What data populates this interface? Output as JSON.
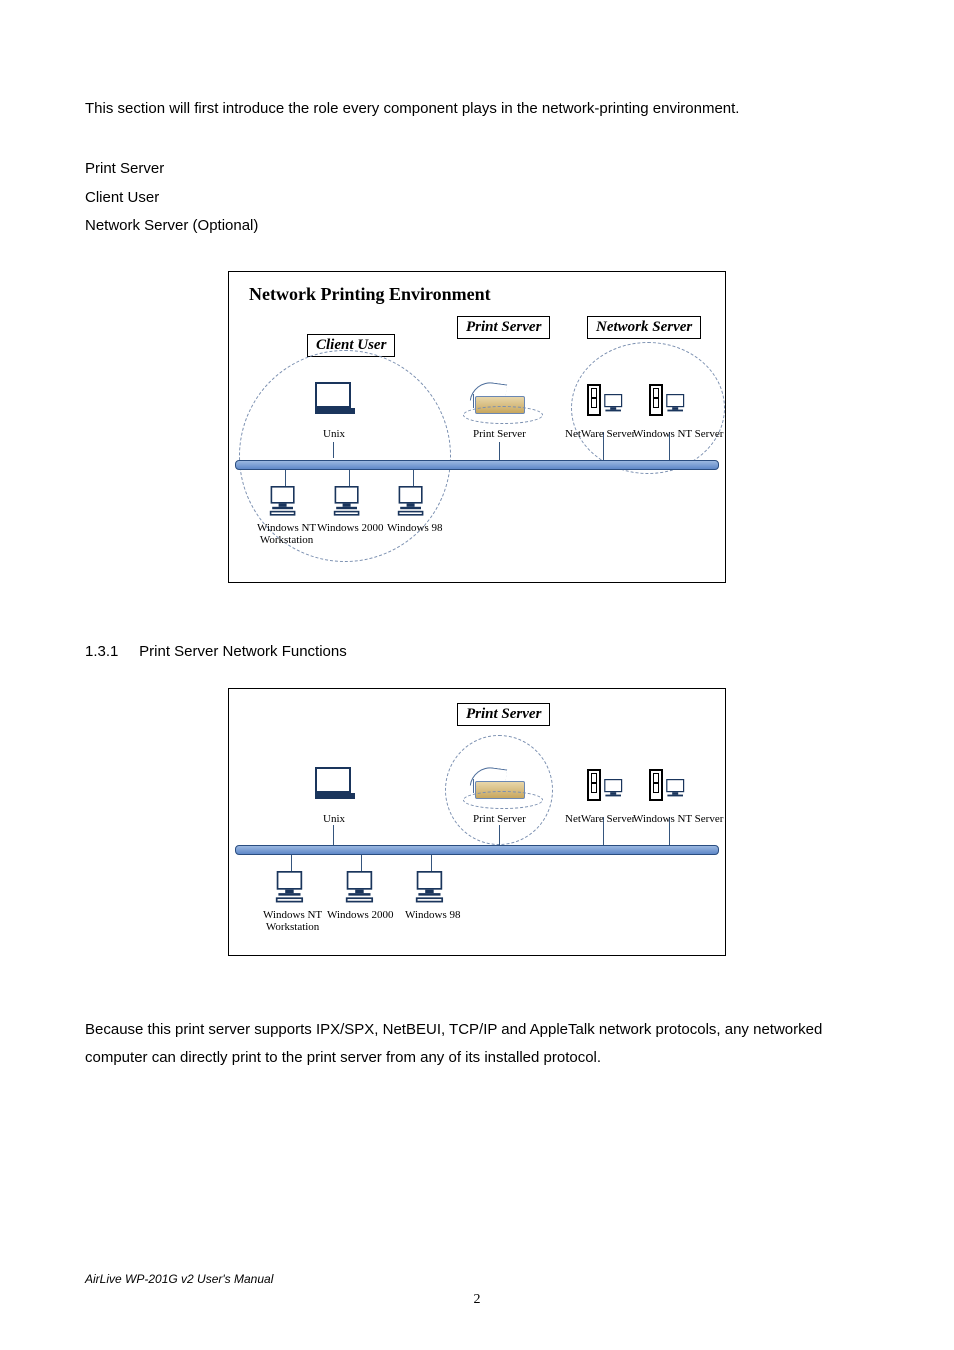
{
  "intro": "This section will first introduce the role every component plays in the network-printing environment.",
  "list": {
    "item1": "Print Server",
    "item2": "Client User",
    "item3": "Network Server (Optional)"
  },
  "fig1": {
    "title": "Network Printing Environment",
    "labels": {
      "client_user": "Client User",
      "print_server": "Print Server",
      "network_server": "Network Server"
    },
    "captions": {
      "unix": "Unix",
      "print_server_device": "Print Server",
      "netware": "NetWare Server",
      "winnt_server": "Windows NT Server",
      "winnt_ws": "Windows NT\nWorkstation",
      "win2000": "Windows 2000",
      "win98": "Windows 98"
    }
  },
  "section": {
    "number": "1.3.1",
    "title": "Print Server Network Functions"
  },
  "fig2": {
    "labels": {
      "print_server": "Print Server"
    },
    "captions": {
      "unix": "Unix",
      "print_server_device": "Print Server",
      "netware": "NetWare Server",
      "winnt_server": "Windows NT Server",
      "winnt_ws": "Windows NT\nWorkstation",
      "win2000": "Windows 2000",
      "win98": "Windows 98"
    }
  },
  "body_para": "Because this print server supports IPX/SPX, NetBEUI, TCP/IP and AppleTalk network protocols, any networked computer can directly print to the print server from any of its installed protocol.",
  "footer": "AirLive WP-201G v2 User's Manual",
  "page_number": "2"
}
